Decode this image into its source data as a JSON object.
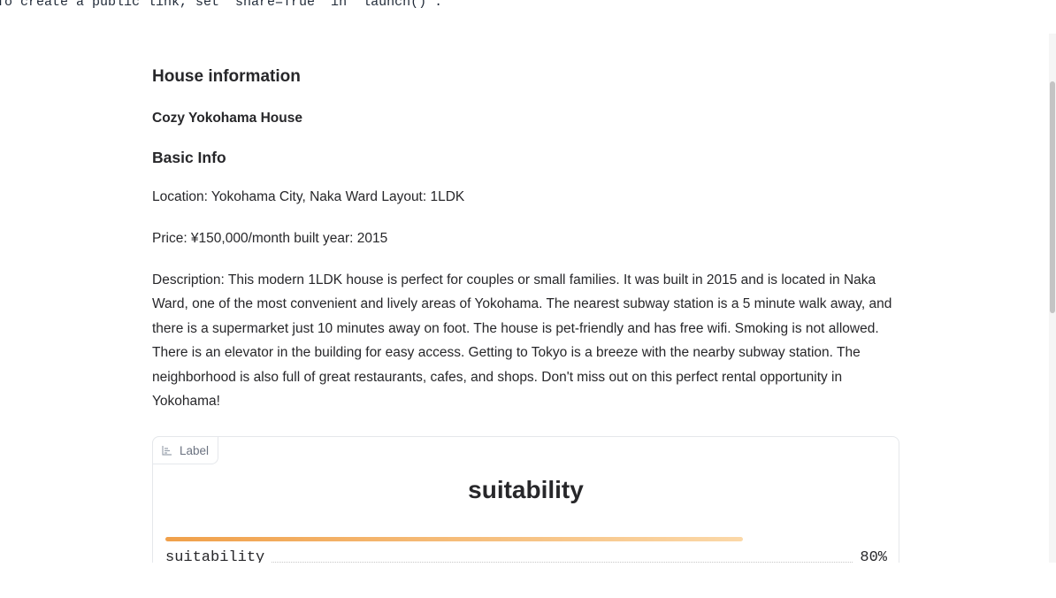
{
  "console": {
    "text": "To create a public link, set `share=True` in `launch()`."
  },
  "markdown": {
    "heading": "House information",
    "house_name": "Cozy Yokohama House",
    "section": "Basic Info",
    "location_layout": "Location: Yokohama City, Naka Ward Layout: 1LDK",
    "price_year": "Price: ¥150,000/month built year: 2015",
    "description": "Description: This modern 1LDK house is perfect for couples or small families. It was built in 2015 and is located in Naka Ward, one of the most convenient and lively areas of Yokohama. The nearest subway station is a 5 minute walk away, and there is a supermarket just 10 minutes away on foot. The house is pet-friendly and has free wifi. Smoking is not allowed. There is an elevator in the building for easy access. Getting to Tokyo is a breeze with the nearby subway station. The neighborhood is also full of great restaurants, cafes, and shops. Don't miss out on this perfect rental opportunity in Yokohama!"
  },
  "label_component": {
    "tag": "Label",
    "tag_icon": "bar-chart-icon",
    "title": "suitability",
    "confidences": [
      {
        "label": "suitability",
        "value": 0.8,
        "display": "80%"
      }
    ],
    "colors": {
      "bar_start": "#f0a04a",
      "bar_end": "#fbd8a8"
    }
  }
}
